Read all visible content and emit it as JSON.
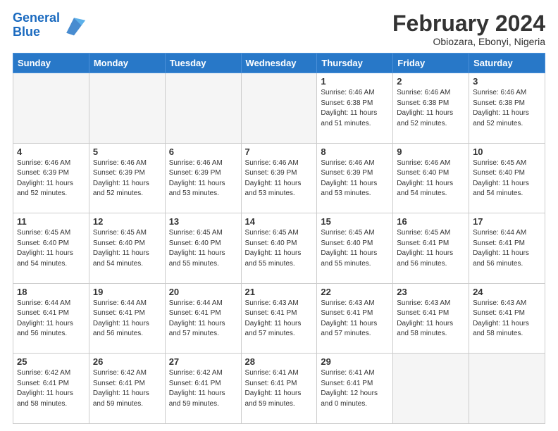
{
  "logo": {
    "line1": "General",
    "line2": "Blue"
  },
  "header": {
    "title": "February 2024",
    "location": "Obiozara, Ebonyi, Nigeria"
  },
  "days_of_week": [
    "Sunday",
    "Monday",
    "Tuesday",
    "Wednesday",
    "Thursday",
    "Friday",
    "Saturday"
  ],
  "weeks": [
    [
      {
        "day": "",
        "info": ""
      },
      {
        "day": "",
        "info": ""
      },
      {
        "day": "",
        "info": ""
      },
      {
        "day": "",
        "info": ""
      },
      {
        "day": "1",
        "info": "Sunrise: 6:46 AM\nSunset: 6:38 PM\nDaylight: 11 hours\nand 51 minutes."
      },
      {
        "day": "2",
        "info": "Sunrise: 6:46 AM\nSunset: 6:38 PM\nDaylight: 11 hours\nand 52 minutes."
      },
      {
        "day": "3",
        "info": "Sunrise: 6:46 AM\nSunset: 6:38 PM\nDaylight: 11 hours\nand 52 minutes."
      }
    ],
    [
      {
        "day": "4",
        "info": "Sunrise: 6:46 AM\nSunset: 6:39 PM\nDaylight: 11 hours\nand 52 minutes."
      },
      {
        "day": "5",
        "info": "Sunrise: 6:46 AM\nSunset: 6:39 PM\nDaylight: 11 hours\nand 52 minutes."
      },
      {
        "day": "6",
        "info": "Sunrise: 6:46 AM\nSunset: 6:39 PM\nDaylight: 11 hours\nand 53 minutes."
      },
      {
        "day": "7",
        "info": "Sunrise: 6:46 AM\nSunset: 6:39 PM\nDaylight: 11 hours\nand 53 minutes."
      },
      {
        "day": "8",
        "info": "Sunrise: 6:46 AM\nSunset: 6:39 PM\nDaylight: 11 hours\nand 53 minutes."
      },
      {
        "day": "9",
        "info": "Sunrise: 6:46 AM\nSunset: 6:40 PM\nDaylight: 11 hours\nand 54 minutes."
      },
      {
        "day": "10",
        "info": "Sunrise: 6:45 AM\nSunset: 6:40 PM\nDaylight: 11 hours\nand 54 minutes."
      }
    ],
    [
      {
        "day": "11",
        "info": "Sunrise: 6:45 AM\nSunset: 6:40 PM\nDaylight: 11 hours\nand 54 minutes."
      },
      {
        "day": "12",
        "info": "Sunrise: 6:45 AM\nSunset: 6:40 PM\nDaylight: 11 hours\nand 54 minutes."
      },
      {
        "day": "13",
        "info": "Sunrise: 6:45 AM\nSunset: 6:40 PM\nDaylight: 11 hours\nand 55 minutes."
      },
      {
        "day": "14",
        "info": "Sunrise: 6:45 AM\nSunset: 6:40 PM\nDaylight: 11 hours\nand 55 minutes."
      },
      {
        "day": "15",
        "info": "Sunrise: 6:45 AM\nSunset: 6:40 PM\nDaylight: 11 hours\nand 55 minutes."
      },
      {
        "day": "16",
        "info": "Sunrise: 6:45 AM\nSunset: 6:41 PM\nDaylight: 11 hours\nand 56 minutes."
      },
      {
        "day": "17",
        "info": "Sunrise: 6:44 AM\nSunset: 6:41 PM\nDaylight: 11 hours\nand 56 minutes."
      }
    ],
    [
      {
        "day": "18",
        "info": "Sunrise: 6:44 AM\nSunset: 6:41 PM\nDaylight: 11 hours\nand 56 minutes."
      },
      {
        "day": "19",
        "info": "Sunrise: 6:44 AM\nSunset: 6:41 PM\nDaylight: 11 hours\nand 56 minutes."
      },
      {
        "day": "20",
        "info": "Sunrise: 6:44 AM\nSunset: 6:41 PM\nDaylight: 11 hours\nand 57 minutes."
      },
      {
        "day": "21",
        "info": "Sunrise: 6:43 AM\nSunset: 6:41 PM\nDaylight: 11 hours\nand 57 minutes."
      },
      {
        "day": "22",
        "info": "Sunrise: 6:43 AM\nSunset: 6:41 PM\nDaylight: 11 hours\nand 57 minutes."
      },
      {
        "day": "23",
        "info": "Sunrise: 6:43 AM\nSunset: 6:41 PM\nDaylight: 11 hours\nand 58 minutes."
      },
      {
        "day": "24",
        "info": "Sunrise: 6:43 AM\nSunset: 6:41 PM\nDaylight: 11 hours\nand 58 minutes."
      }
    ],
    [
      {
        "day": "25",
        "info": "Sunrise: 6:42 AM\nSunset: 6:41 PM\nDaylight: 11 hours\nand 58 minutes."
      },
      {
        "day": "26",
        "info": "Sunrise: 6:42 AM\nSunset: 6:41 PM\nDaylight: 11 hours\nand 59 minutes."
      },
      {
        "day": "27",
        "info": "Sunrise: 6:42 AM\nSunset: 6:41 PM\nDaylight: 11 hours\nand 59 minutes."
      },
      {
        "day": "28",
        "info": "Sunrise: 6:41 AM\nSunset: 6:41 PM\nDaylight: 11 hours\nand 59 minutes."
      },
      {
        "day": "29",
        "info": "Sunrise: 6:41 AM\nSunset: 6:41 PM\nDaylight: 12 hours\nand 0 minutes."
      },
      {
        "day": "",
        "info": ""
      },
      {
        "day": "",
        "info": ""
      }
    ]
  ]
}
